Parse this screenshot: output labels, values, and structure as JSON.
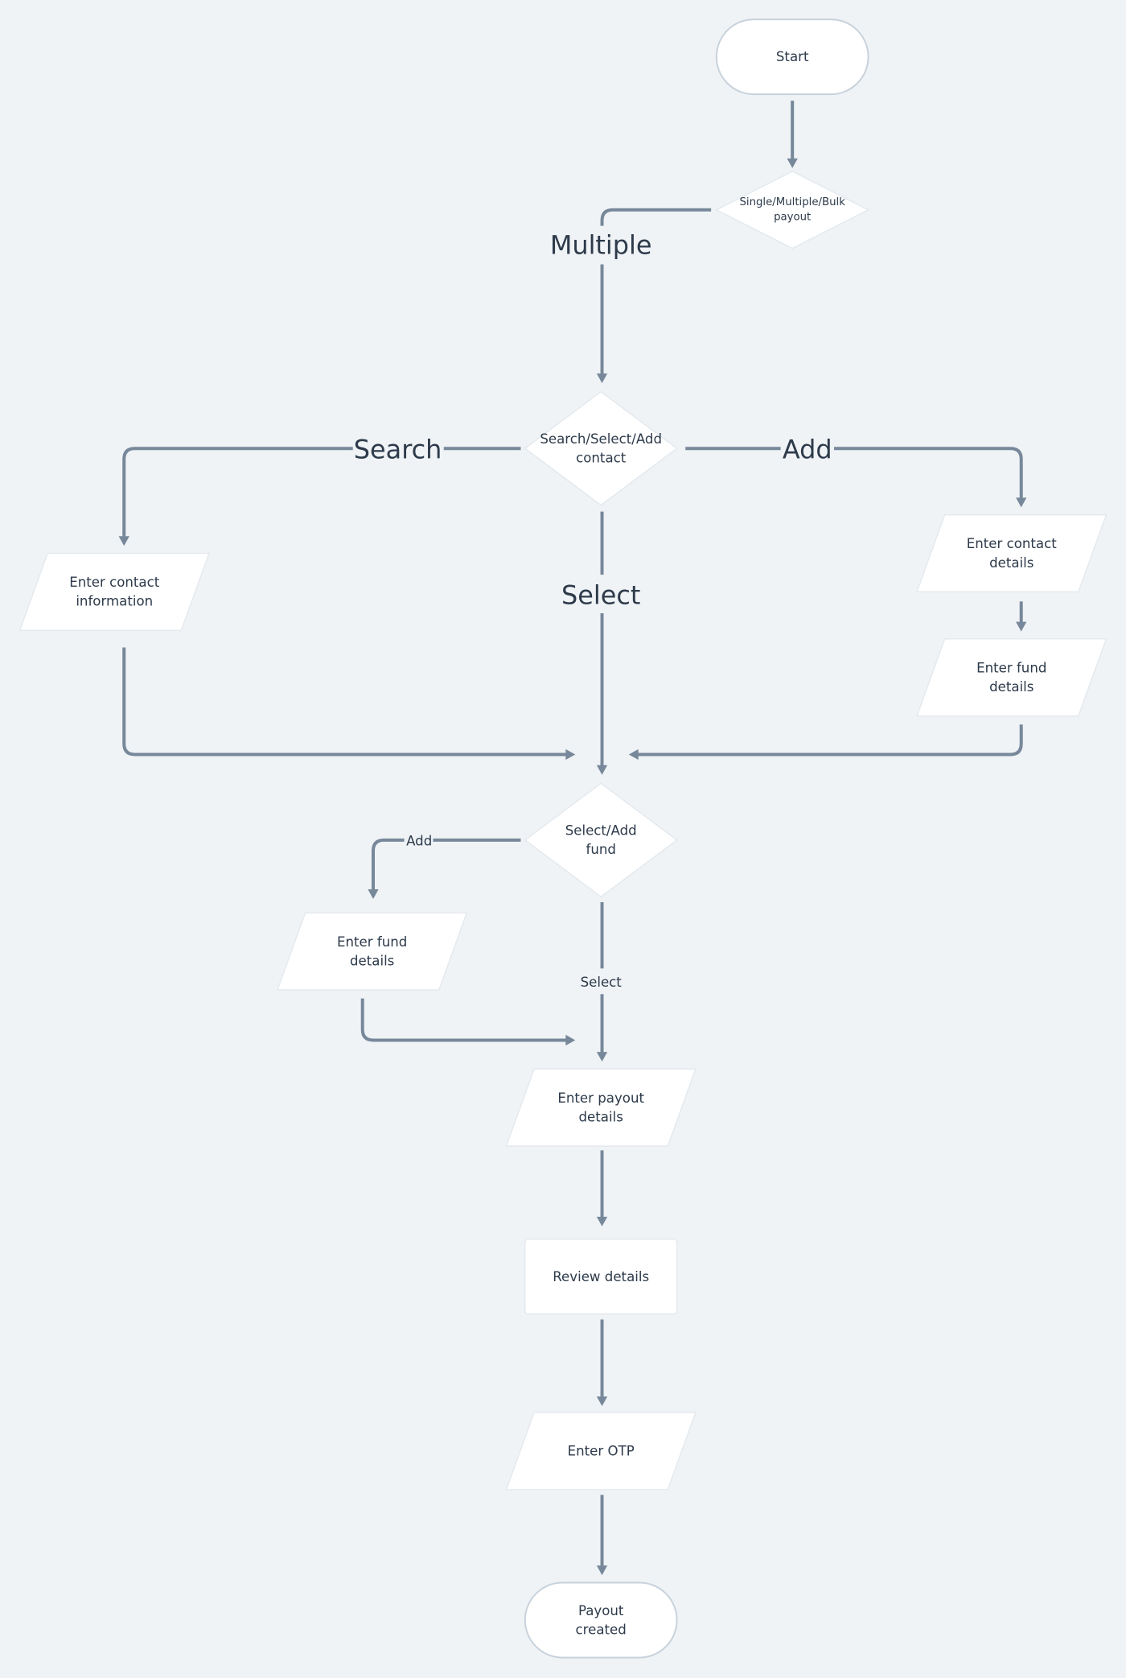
{
  "colors": {
    "background": "#eff3f6",
    "connector": "#77889a",
    "text": "#2d3a4a",
    "node_fill": "#ffffff",
    "terminal_border": "#c8d2dc"
  },
  "nodes": {
    "start": {
      "shape": "terminal",
      "lines": [
        "Start"
      ]
    },
    "payout_type": {
      "shape": "decision",
      "lines": [
        "Single/Multiple/Bulk",
        "payout"
      ]
    },
    "contact_choice": {
      "shape": "decision",
      "lines": [
        "Search/Select/Add",
        "contact"
      ]
    },
    "enter_contact_info": {
      "shape": "input",
      "lines": [
        "Enter contact",
        "information"
      ]
    },
    "enter_contact_details": {
      "shape": "input",
      "lines": [
        "Enter contact",
        "details"
      ]
    },
    "enter_fund_details_contact": {
      "shape": "input",
      "lines": [
        "Enter fund",
        "details"
      ]
    },
    "fund_choice": {
      "shape": "decision",
      "lines": [
        "Select/Add",
        "fund"
      ]
    },
    "enter_fund_details": {
      "shape": "input",
      "lines": [
        "Enter fund",
        "details"
      ]
    },
    "enter_payout_details": {
      "shape": "input",
      "lines": [
        "Enter payout",
        "details"
      ]
    },
    "review_details": {
      "shape": "process",
      "lines": [
        "Review details"
      ]
    },
    "enter_otp": {
      "shape": "input",
      "lines": [
        "Enter OTP"
      ]
    },
    "payout_created": {
      "shape": "terminal",
      "lines": [
        "Payout",
        "created"
      ]
    }
  },
  "edge_labels": {
    "multiple": "Multiple",
    "search": "Search",
    "add_contact": "Add",
    "select_contact": "Select",
    "add_fund": "Add",
    "select_fund": "Select"
  }
}
